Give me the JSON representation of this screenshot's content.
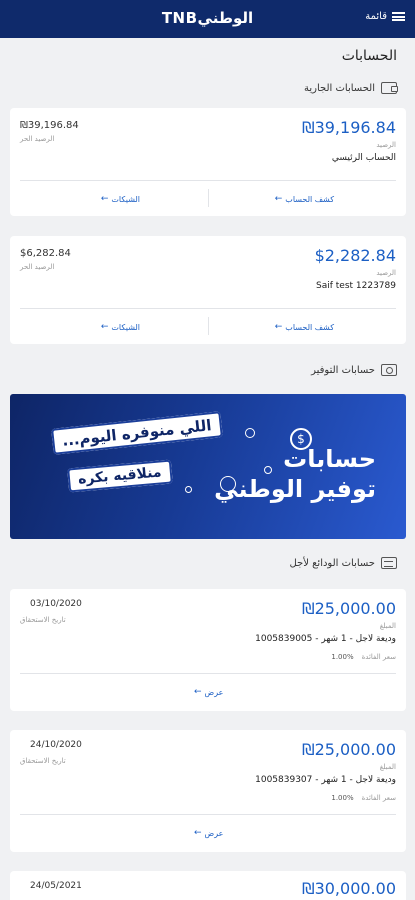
{
  "header": {
    "logo": "TNBالوطني",
    "menu_label": "قائمة"
  },
  "page_title": "الحسابات",
  "sections": {
    "current": "الحسابات الجارية",
    "savings": "حسابات التوفير",
    "deposits": "حسابات الودائع لأجل"
  },
  "current_accounts": [
    {
      "amount": "₪39,196.84",
      "amount_label": "الرصيد",
      "name": "الحساب الرئيسي",
      "available_amount": "₪39,196.84",
      "available_label": "الرصيد الحر",
      "statement_link": "كشف الحساب",
      "cheques_link": "الشيكات"
    },
    {
      "amount": "$2,282.84",
      "amount_label": "الرصيد",
      "name": "Saif test 1223789",
      "available_amount": "$6,282.84",
      "available_label": "الرصيد الحر",
      "statement_link": "كشف الحساب",
      "cheques_link": "الشيكات"
    }
  ],
  "banner": {
    "tag1": "اللي منوفره اليوم...",
    "tag2": "منلاقيه بكره",
    "title_line1": "حسابات",
    "title_line2": "توفير الوطني"
  },
  "deposits": [
    {
      "amount": "₪25,000.00",
      "amount_label": "المبلغ",
      "name": "وديعة لاجل - 1 شهر - 1005839005",
      "rate_label": "سعر الفائدة",
      "rate_value": "1.00%",
      "date": "03/10/2020",
      "date_label": "تاريخ الاستحقاق",
      "view_link": "عرض"
    },
    {
      "amount": "₪25,000.00",
      "amount_label": "المبلغ",
      "name": "وديعة لاجل - 1 شهر - 1005839307",
      "rate_label": "سعر الفائدة",
      "rate_value": "1.00%",
      "date": "24/10/2020",
      "date_label": "تاريخ الاستحقاق",
      "view_link": "عرض"
    },
    {
      "amount": "₪30,000.00",
      "date": "24/05/2021"
    }
  ],
  "colors": {
    "header": "#0f2a6b",
    "accent": "#1c5fc4",
    "background": "#f0f1f3"
  }
}
